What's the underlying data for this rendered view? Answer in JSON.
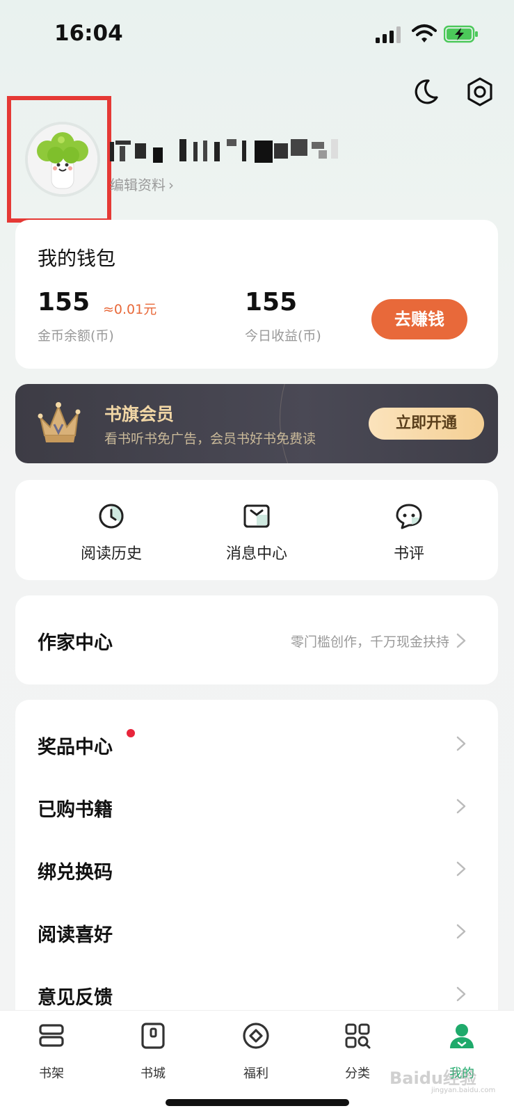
{
  "status_bar": {
    "time": "16:04"
  },
  "profile": {
    "edit_label": "编辑资料",
    "chevron": "›"
  },
  "wallet": {
    "title": "我的钱包",
    "coin_balance": "155",
    "coin_approx": "≈0.01元",
    "coin_label": "金币余额(币)",
    "today_value": "155",
    "today_label": "今日收益(币)",
    "earn_button": "去赚钱",
    "accent_color": "#e8693a"
  },
  "vip": {
    "title": "书旗会员",
    "description": "看书听书免广告，会员书好书免费读",
    "button": "立即开通"
  },
  "shortcuts": [
    {
      "label": "阅读历史",
      "icon": "clock-icon"
    },
    {
      "label": "消息中心",
      "icon": "message-box-icon"
    },
    {
      "label": "书评",
      "icon": "comment-bubble-icon"
    }
  ],
  "writer": {
    "title": "作家中心",
    "subtitle": "零门槛创作，千万现金扶持"
  },
  "menu": [
    {
      "label": "奖品中心",
      "badge": true
    },
    {
      "label": "已购书籍"
    },
    {
      "label": "绑兑换码"
    },
    {
      "label": "阅读喜好"
    },
    {
      "label": "意见反馈"
    }
  ],
  "tabbar": [
    {
      "label": "书架",
      "icon": "bookshelf-icon"
    },
    {
      "label": "书城",
      "icon": "bookstore-icon"
    },
    {
      "label": "福利",
      "icon": "welfare-icon"
    },
    {
      "label": "分类",
      "icon": "category-icon"
    },
    {
      "label": "我的",
      "icon": "profile-icon",
      "active": true
    }
  ],
  "watermark": {
    "text": "Baidu经验",
    "sub": "jingyan.baidu.com"
  }
}
